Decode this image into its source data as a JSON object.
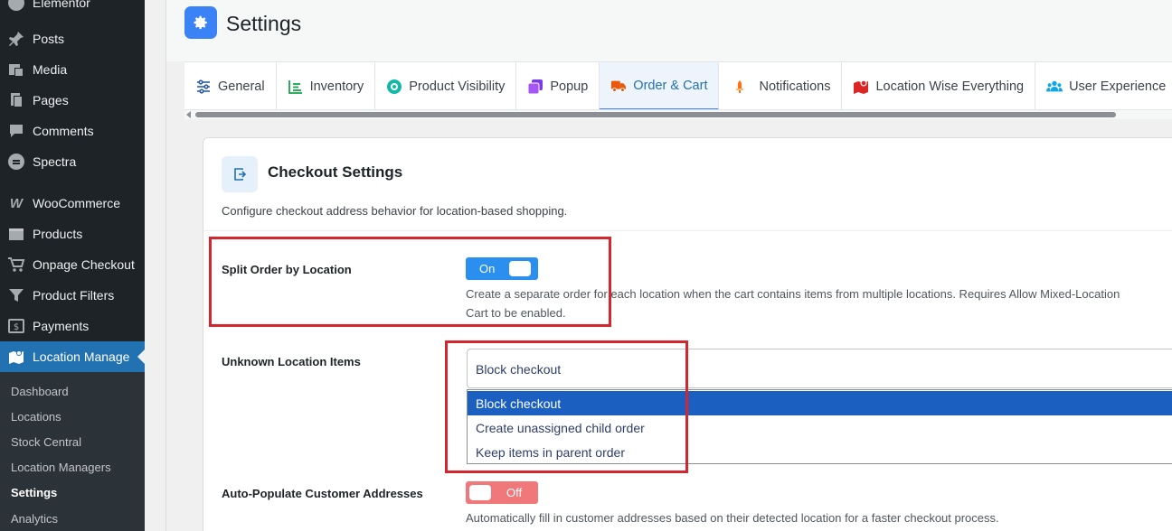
{
  "sidebar": {
    "items": [
      {
        "label": "Elementor",
        "icon": "elementor-icon"
      },
      {
        "label": "Posts",
        "icon": "pin-icon"
      },
      {
        "label": "Media",
        "icon": "media-icon"
      },
      {
        "label": "Pages",
        "icon": "pages-icon"
      },
      {
        "label": "Comments",
        "icon": "comments-icon"
      },
      {
        "label": "Spectra",
        "icon": "spectra-icon"
      },
      {
        "label": "WooCommerce",
        "icon": "woocommerce-icon"
      },
      {
        "label": "Products",
        "icon": "products-icon"
      },
      {
        "label": "Onpage Checkout",
        "icon": "cart-icon"
      },
      {
        "label": "Product Filters",
        "icon": "filter-icon"
      },
      {
        "label": "Payments",
        "icon": "payments-icon"
      },
      {
        "label": "Location Manage",
        "icon": "map-icon"
      }
    ],
    "submenu": [
      "Dashboard",
      "Locations",
      "Stock Central",
      "Location Managers",
      "Settings",
      "Analytics"
    ]
  },
  "header": {
    "title": "Settings"
  },
  "tabs": [
    {
      "label": "General",
      "icon": "sliders-icon"
    },
    {
      "label": "Inventory",
      "icon": "chart-icon"
    },
    {
      "label": "Product Visibility",
      "icon": "eye-icon"
    },
    {
      "label": "Popup",
      "icon": "popup-icon"
    },
    {
      "label": "Order & Cart",
      "icon": "truck-icon"
    },
    {
      "label": "Notifications",
      "icon": "bell-icon"
    },
    {
      "label": "Location Wise Everything",
      "icon": "map-marker-icon"
    },
    {
      "label": "User Experience",
      "icon": "users-icon"
    }
  ],
  "card": {
    "title": "Checkout Settings",
    "description": "Configure checkout address behavior for location-based shopping.",
    "icon": "checkout-icon"
  },
  "fields": {
    "split": {
      "label": "Split Order by Location",
      "toggle": "On",
      "help_line1": "Create a separate order for each location when the cart contains items from multiple locations. Requires Allow Mixed-Location",
      "help_line2": "Cart to be enabled."
    },
    "unknown": {
      "label": "Unknown Location Items",
      "value": "Block checkout",
      "options": [
        "Block checkout",
        "Create unassigned child order",
        "Keep items in parent order"
      ]
    },
    "autopop": {
      "label": "Auto-Populate Customer Addresses",
      "toggle": "Off",
      "help": "Automatically fill in customer addresses based on their detected location for a faster checkout process."
    }
  },
  "colors": {
    "sidebar_bg": "#1d2327",
    "accent": "#2271b1",
    "toggle_on": "#2b8ff0",
    "toggle_off": "#f0787a",
    "highlight": "#d3262e"
  }
}
